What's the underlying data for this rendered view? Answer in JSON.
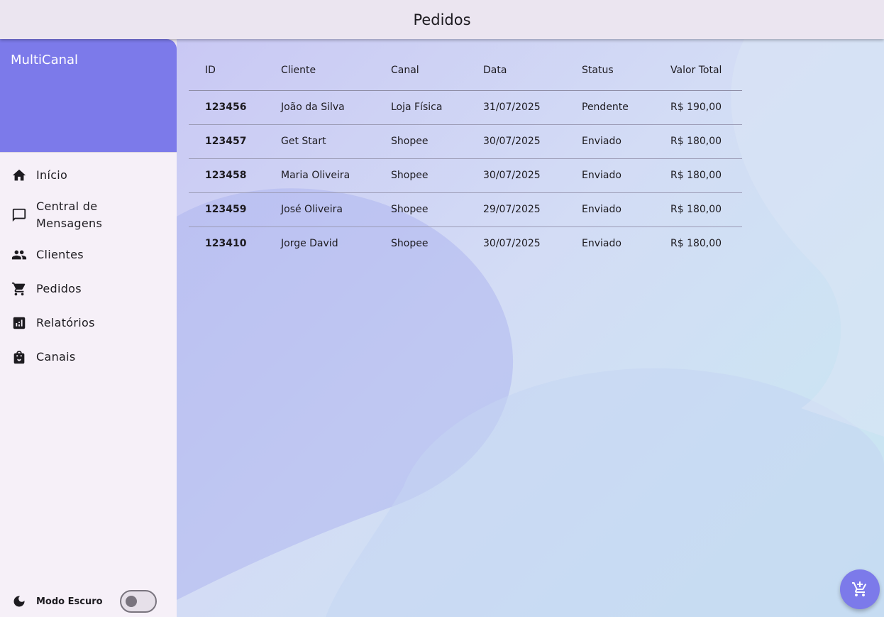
{
  "appbar": {
    "title": "Pedidos"
  },
  "drawer": {
    "brand": "MultiCanal",
    "items": [
      {
        "label": "Início",
        "icon": "home-icon"
      },
      {
        "label": "Central de Mensagens",
        "icon": "message-icon"
      },
      {
        "label": "Clientes",
        "icon": "people-icon"
      },
      {
        "label": "Pedidos",
        "icon": "shopping-cart-icon"
      },
      {
        "label": "Relatórios",
        "icon": "bar-chart-icon"
      },
      {
        "label": "Canais",
        "icon": "shopping-bag-icon"
      }
    ],
    "footer": {
      "dark_mode_label": "Modo Escuro",
      "dark_mode_on": false,
      "icon": "moon-icon"
    }
  },
  "orders": {
    "columns": [
      "ID",
      "Cliente",
      "Canal",
      "Data",
      "Status",
      "Valor Total"
    ],
    "rows": [
      [
        "123456",
        "João da Silva",
        "Loja Física",
        "31/07/2025",
        "Pendente",
        "R$ 190,00"
      ],
      [
        "123457",
        "Get Start",
        "Shopee",
        "30/07/2025",
        "Enviado",
        "R$ 180,00"
      ],
      [
        "123458",
        "Maria Oliveira",
        "Shopee",
        "30/07/2025",
        "Enviado",
        "R$ 180,00"
      ],
      [
        "123459",
        "José Oliveira",
        "Shopee",
        "29/07/2025",
        "Enviado",
        "R$ 180,00"
      ],
      [
        "123410",
        "Jorge David",
        "Shopee",
        "30/07/2025",
        "Enviado",
        "R$ 180,00"
      ]
    ]
  },
  "fab": {
    "icon": "add-shopping-cart-icon"
  },
  "colors": {
    "accent": "#7c7aea",
    "appbar": "#ebe5f0",
    "drawer": "#f6f0f8"
  }
}
